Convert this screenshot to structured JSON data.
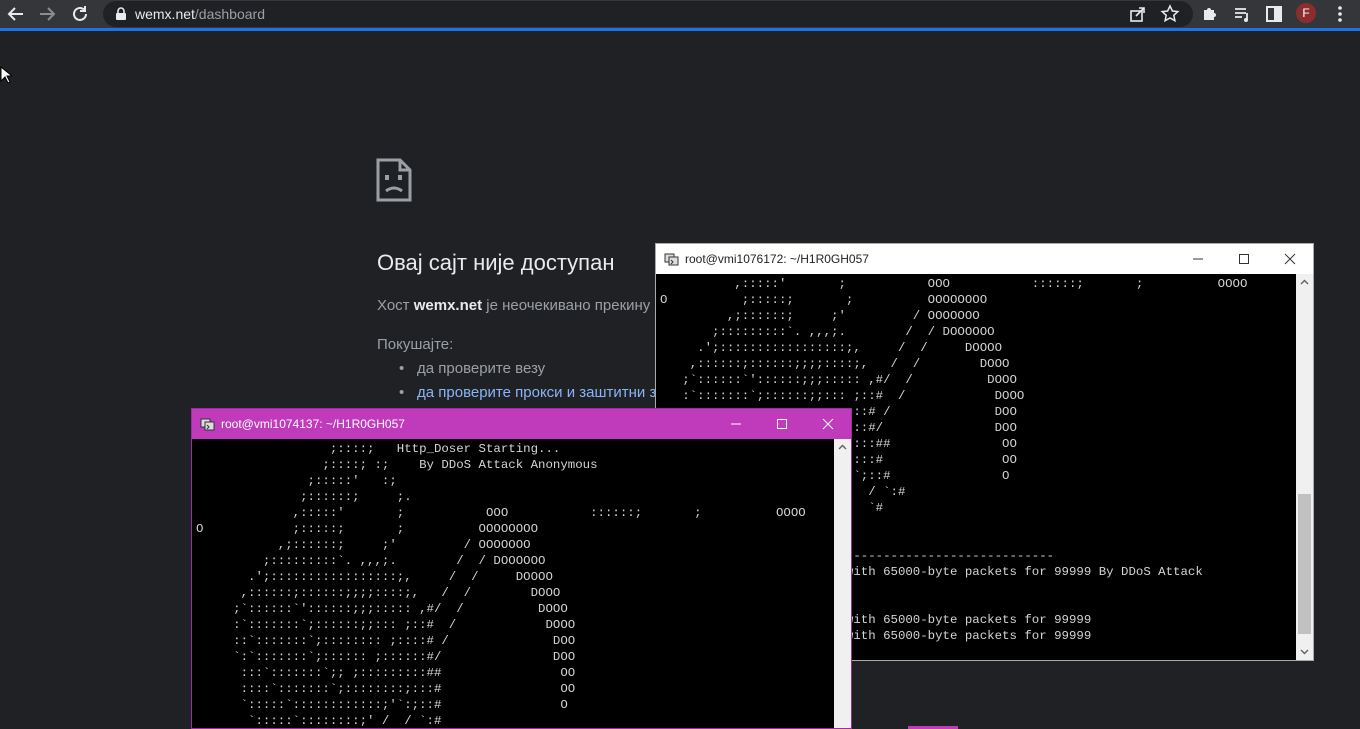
{
  "browser": {
    "url_host": "wemx.net",
    "url_path": "/dashboard",
    "profile_initial": "F",
    "accent_color": "#1a73e8"
  },
  "error_page": {
    "title": "Овај сајт није доступан",
    "host_prefix": "Хост ",
    "host_name": "wemx.net",
    "host_suffix": " је неочекивано прекину",
    "try_label": "Покушајте:",
    "suggestions": [
      "да проверите везу",
      "да проверите прокси и заштитни з"
    ]
  },
  "terminals": [
    {
      "title": "root@vmi1076172: ~/H1R0GH057",
      "lines": [
        "          ,:::::'       ;           OOO           ::::::;       ;          OOOO",
        "O          ;:::::;       ;          OOOOOOOO",
        "         ,;::::::;     ;'         / OOOOOOO",
        "       ;:::::::::`. ,,,;.        /  / DOOOOOO",
        "     .';:::::::::::::::::;,     /  /     DOOOO",
        "    ,::::::;::::::;;;;::::;,   /  /        DOOO",
        "   ;`::::::`'::::::;;;::::: ,#/  /          DOOO",
        "   :`:::::::`;::::::;;::: ;::#  /            DOOO",
        "                        ::::# /              DOO",
        "                        ::::#/               DOO",
        "                        :::::##               OO",
        "                        :;:::#                OO",
        "                        ;'`;::#               O",
        "                        ;'  / `:#",
        "                        '   `#",
        "",
        "",
        "                         ----------------------------",
        "                         with 65000-byte packets for 99999 By DDoS Attack",
        "",
        "",
        "                         with 65000-byte packets for 99999",
        "                         with 65000-byte packets for 99999"
      ]
    },
    {
      "title": "root@vmi1074137: ~/H1R0GH057",
      "lines": [
        "                  ;::::;   Http_Doser Starting...",
        "                 ;::::; :;    By DDoS Attack Anonymous",
        "               ;:::::'   :;",
        "              ;::::::;     ;.",
        "             ,:::::'       ;           OOO           ::::::;       ;          OOOO",
        "O            ;:::::;       ;          OOOOOOOO",
        "           ,;::::::;     ;'         / OOOOOOO",
        "         ;:::::::::`. ,,,;.        /  / DOOOOOO",
        "       .';:::::::::::::::::;,     /  /     DOOOO",
        "      ,::::::;::::::;;;;::::;,   /  /        DOOO",
        "     ;`::::::`'::::::;;;::::: ,#/  /          DOOO",
        "     :`:::::::`;::::::;;::: ;::#  /            DOOO",
        "     ::`:::::::`;:::::::: ;::::# /              DOO",
        "     `:`:::::::`;:::::: ;::::::#/               DOO",
        "      :::`:::::::`;; ;:::::::::##                OO",
        "      ::::`:::::::`;::::::::;:::#                OO",
        "      `:::::`::::::::::::;'`:;::#                O",
        "       `:::::`::::::::;' /  / `:#"
      ]
    }
  ]
}
